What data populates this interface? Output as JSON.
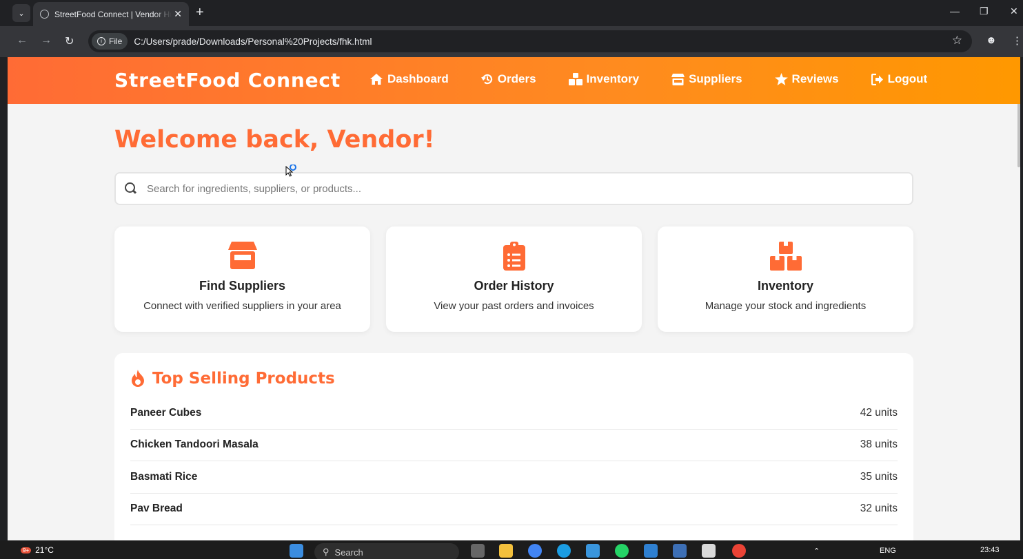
{
  "browser": {
    "tab_title": "StreetFood Connect | Vendor Hub",
    "chip_label": "File",
    "url": "C:/Users/prade/Downloads/Personal%20Projects/fhk.html"
  },
  "site": {
    "logo": "StreetFood Connect",
    "nav": [
      {
        "label": "Dashboard",
        "icon": "home-icon"
      },
      {
        "label": "Orders",
        "icon": "history-icon"
      },
      {
        "label": "Inventory",
        "icon": "boxes-icon"
      },
      {
        "label": "Suppliers",
        "icon": "store-icon"
      },
      {
        "label": "Reviews",
        "icon": "star-icon"
      },
      {
        "label": "Logout",
        "icon": "logout-icon"
      }
    ]
  },
  "main": {
    "welcome": "Welcome back, Vendor!",
    "search_placeholder": "Search for ingredients, suppliers, or products...",
    "cards": [
      {
        "title": "Find Suppliers",
        "desc": "Connect with verified suppliers in your area",
        "icon": "store-icon"
      },
      {
        "title": "Order History",
        "desc": "View your past orders and invoices",
        "icon": "clipboard-list-icon"
      },
      {
        "title": "Inventory",
        "desc": "Manage your stock and ingredients",
        "icon": "boxes-icon"
      }
    ],
    "top_products": {
      "title": "Top Selling Products",
      "items": [
        {
          "name": "Paneer Cubes",
          "units": "42 units"
        },
        {
          "name": "Chicken Tandoori Masala",
          "units": "38 units"
        },
        {
          "name": "Basmati Rice",
          "units": "35 units"
        },
        {
          "name": "Pav Bread",
          "units": "32 units"
        }
      ]
    }
  },
  "colors": {
    "accent": "#ff6b35",
    "header_gradient_end": "#ff9800"
  },
  "taskbar": {
    "weather": "21°C",
    "badge": "9+",
    "search": "Search",
    "lang": "ENG",
    "time": "23:43"
  }
}
